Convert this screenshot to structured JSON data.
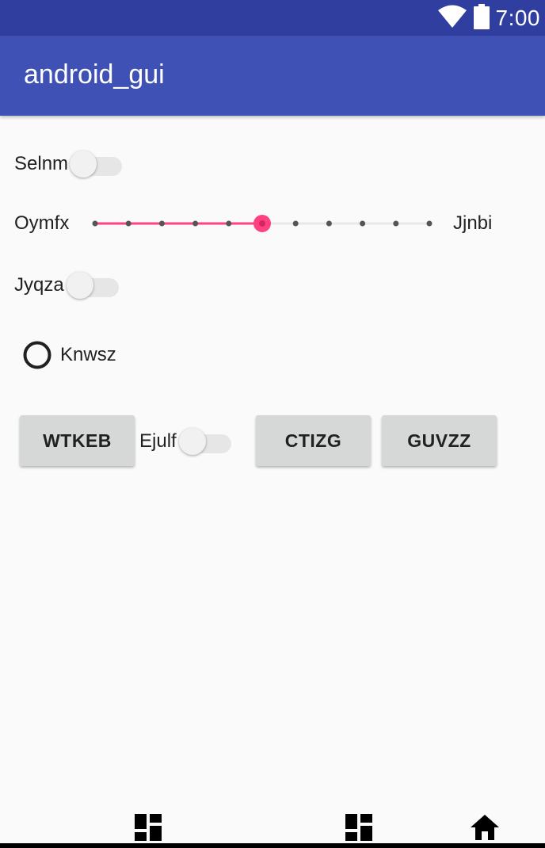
{
  "status_bar": {
    "time": "7:00",
    "icons": [
      "wifi-icon",
      "battery-icon"
    ]
  },
  "app_bar": {
    "title": "android_gui"
  },
  "controls": {
    "switch_1": {
      "label": "Selnm",
      "checked": false
    },
    "slider": {
      "left_label": "Oymfx",
      "right_label": "Jjnbi",
      "ticks": 11,
      "value_index": 5
    },
    "switch_2": {
      "label": "Jyqza",
      "checked": false
    },
    "radio": {
      "label": "Knwsz",
      "checked": false
    },
    "button_1": {
      "label": "WTKEB"
    },
    "switch_3": {
      "label": "Ejulf",
      "checked": false
    },
    "button_2": {
      "label": "CTIZG"
    },
    "button_3": {
      "label": "GUVZZ"
    }
  },
  "bottom_nav": {
    "icons": [
      "dashboard-icon",
      "dashboard-icon",
      "home-icon"
    ]
  },
  "colors": {
    "status_bar": "#303f9f",
    "app_bar": "#3f51b5",
    "accent": "#ff4081",
    "background": "#fafafa",
    "button": "#d6d7d7"
  }
}
